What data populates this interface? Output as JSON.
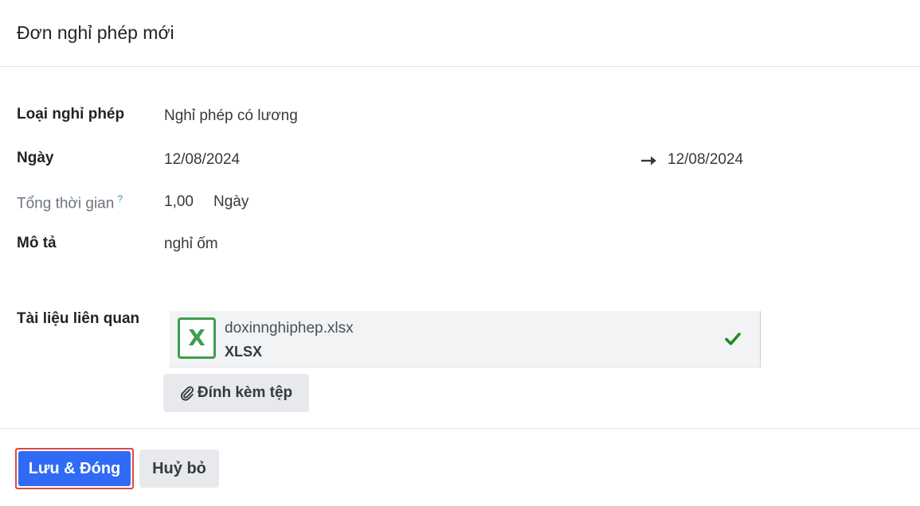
{
  "dialog": {
    "title": "Đơn nghỉ phép mới"
  },
  "form": {
    "leave_type": {
      "label": "Loại nghỉ phép",
      "value": "Nghỉ phép có lương"
    },
    "dates": {
      "label": "Ngày",
      "start": "12/08/2024",
      "end": "12/08/2024"
    },
    "duration": {
      "label": "Tổng thời gian",
      "help_marker": "?",
      "value": "1,00",
      "unit": "Ngày"
    },
    "description": {
      "label": "Mô tả",
      "value": "nghỉ ốm"
    },
    "documents": {
      "label": "Tài liệu liên quan",
      "attachment": {
        "icon": "excel-file-icon",
        "icon_letter": "X",
        "file_name": "doxinnghiphep.xlsx",
        "file_type": "XLSX",
        "status_icon": "check-icon",
        "status_color": "#1e8a1e"
      },
      "attach_button_label": "Đính kèm tệp",
      "attach_button_icon": "paperclip-icon"
    }
  },
  "footer": {
    "save_label": "Lưu & Đóng",
    "cancel_label": "Huỷ bỏ"
  },
  "colors": {
    "primary": "#2f6bf5",
    "highlight_border": "#e04848",
    "excel_green": "#3f9e4f"
  }
}
